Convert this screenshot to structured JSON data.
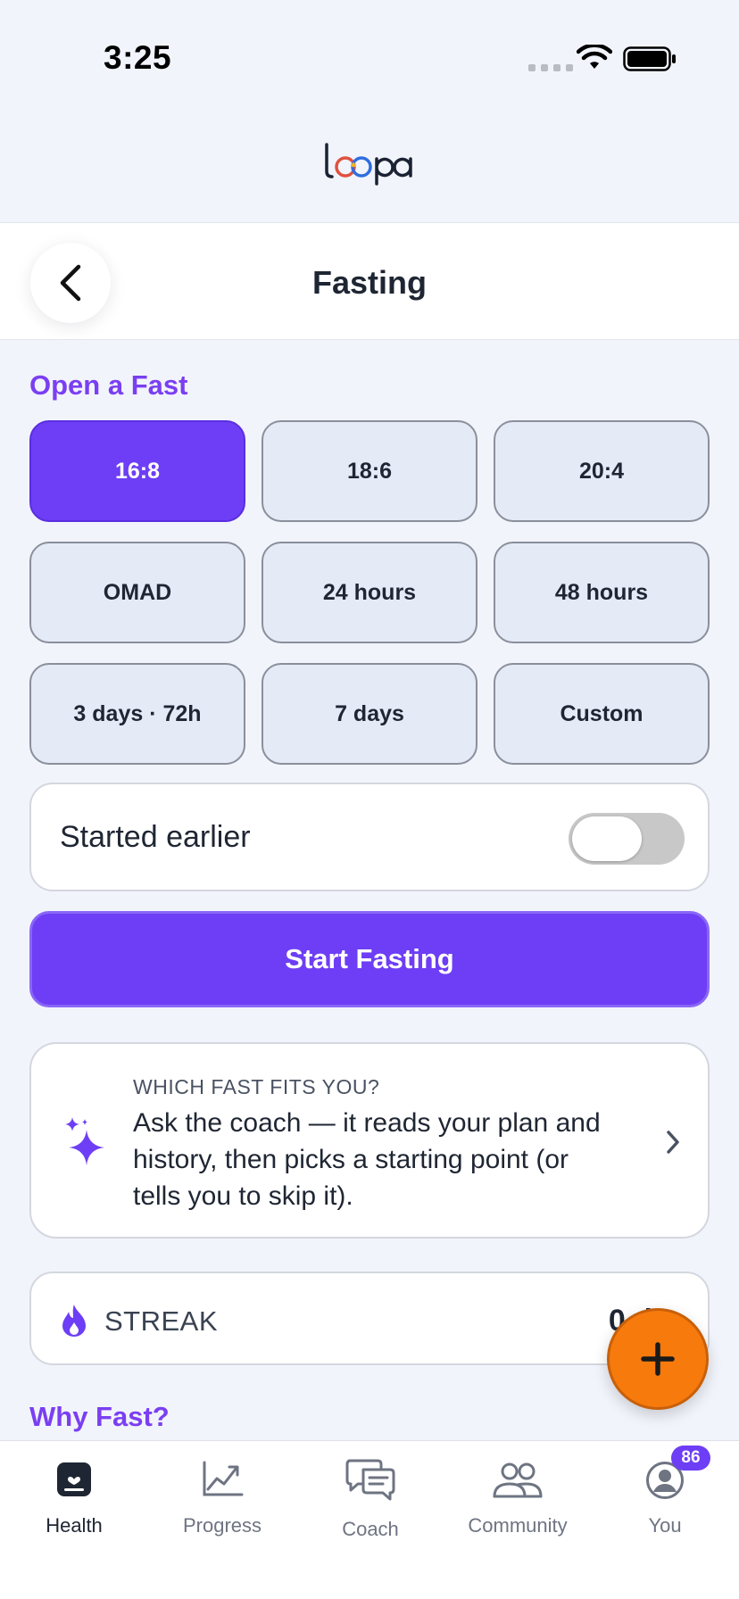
{
  "status_bar": {
    "time": "3:25"
  },
  "brand": {
    "name": "loopa",
    "colors": {
      "ring1": "#e0513f",
      "ring2": "#2f6de0",
      "ring3": "#f2b320"
    }
  },
  "header": {
    "title": "Fasting",
    "back_icon": "chevron-left-icon"
  },
  "open_fast": {
    "title": "Open a Fast",
    "plans": [
      {
        "label": "16:8",
        "selected": true
      },
      {
        "label": "18:6",
        "selected": false
      },
      {
        "label": "20:4",
        "selected": false
      },
      {
        "label": "OMAD",
        "selected": false
      },
      {
        "label": "24 hours",
        "selected": false
      },
      {
        "label": "48 hours",
        "selected": false
      },
      {
        "label": "3 days · 72h",
        "selected": false
      },
      {
        "label": "7 days",
        "selected": false
      },
      {
        "label": "Custom",
        "selected": false
      }
    ]
  },
  "started_earlier": {
    "label": "Started earlier",
    "on": false
  },
  "start_button": {
    "label": "Start Fasting"
  },
  "coach_card": {
    "eyebrow": "WHICH FAST FITS YOU?",
    "body": "Ask the coach — it reads your plan and history, then picks a starting point (or tells you to skip it).",
    "icon": "sparkle-icon"
  },
  "streak": {
    "label": "STREAK",
    "value": "0 d",
    "icon": "flame-icon"
  },
  "why_fast": {
    "title": "Why Fast?"
  },
  "fab": {
    "icon": "plus-icon"
  },
  "tabs": [
    {
      "label": "Health",
      "icon": "health-icon",
      "active": true
    },
    {
      "label": "Progress",
      "icon": "chart-icon",
      "active": false
    },
    {
      "label": "Coach",
      "icon": "chat-icon",
      "active": false
    },
    {
      "label": "Community",
      "icon": "people-icon",
      "active": false
    },
    {
      "label": "You",
      "icon": "profile-icon",
      "active": false
    }
  ],
  "you_badge": "86",
  "accent_color": "#6d3ef5",
  "fab_color": "#f77a0c"
}
